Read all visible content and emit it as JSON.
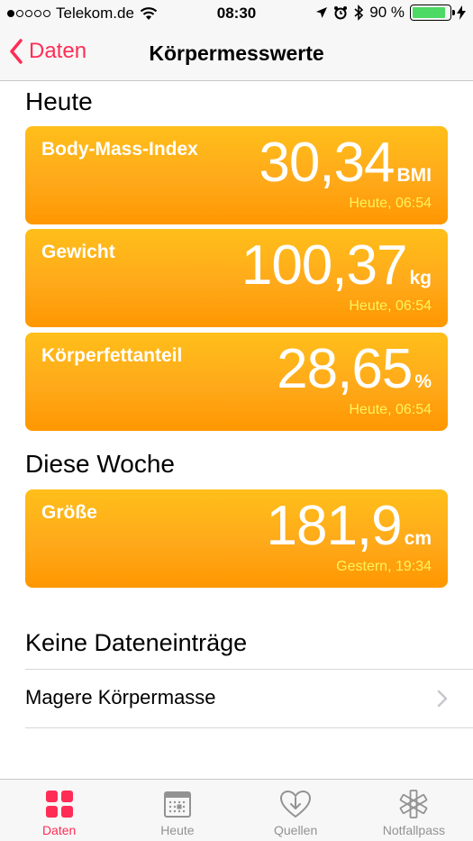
{
  "status_bar": {
    "carrier": "Telekom.de",
    "time": "08:30",
    "battery_percent": "90 %",
    "battery_level": 0.9,
    "icons": [
      "location-icon",
      "alarm-icon",
      "bluetooth-icon",
      "charging-icon"
    ]
  },
  "nav": {
    "back_label": "Daten",
    "title": "Körpermesswerte"
  },
  "sections": {
    "today_title": "Heute",
    "week_title": "Diese Woche",
    "no_entries_title": "Keine Dateneinträge"
  },
  "cards": [
    {
      "label": "Body-Mass-Index",
      "value": "30,34",
      "unit": "BMI",
      "time": "Heute, 06:54"
    },
    {
      "label": "Gewicht",
      "value": "100,37",
      "unit": "kg",
      "time": "Heute, 06:54"
    },
    {
      "label": "Körperfettanteil",
      "value": "28,65",
      "unit": "%",
      "time": "Heute, 06:54"
    },
    {
      "label": "Größe",
      "value": "181,9",
      "unit": "cm",
      "time": "Gestern, 19:34"
    }
  ],
  "list": {
    "items": [
      {
        "label": "Magere Körpermasse"
      }
    ]
  },
  "tabs": [
    {
      "label": "Daten",
      "icon": "grid-icon",
      "active": true
    },
    {
      "label": "Heute",
      "icon": "calendar-icon",
      "active": false
    },
    {
      "label": "Quellen",
      "icon": "heart-download-icon",
      "active": false
    },
    {
      "label": "Notfallpass",
      "icon": "medical-star-icon",
      "active": false
    }
  ],
  "colors": {
    "accent": "#ff2d55",
    "card_gradient_top": "#ffbf1a",
    "card_gradient_bottom": "#ff9700",
    "card_time_text": "#fff35c",
    "battery_fill": "#4cd964"
  }
}
